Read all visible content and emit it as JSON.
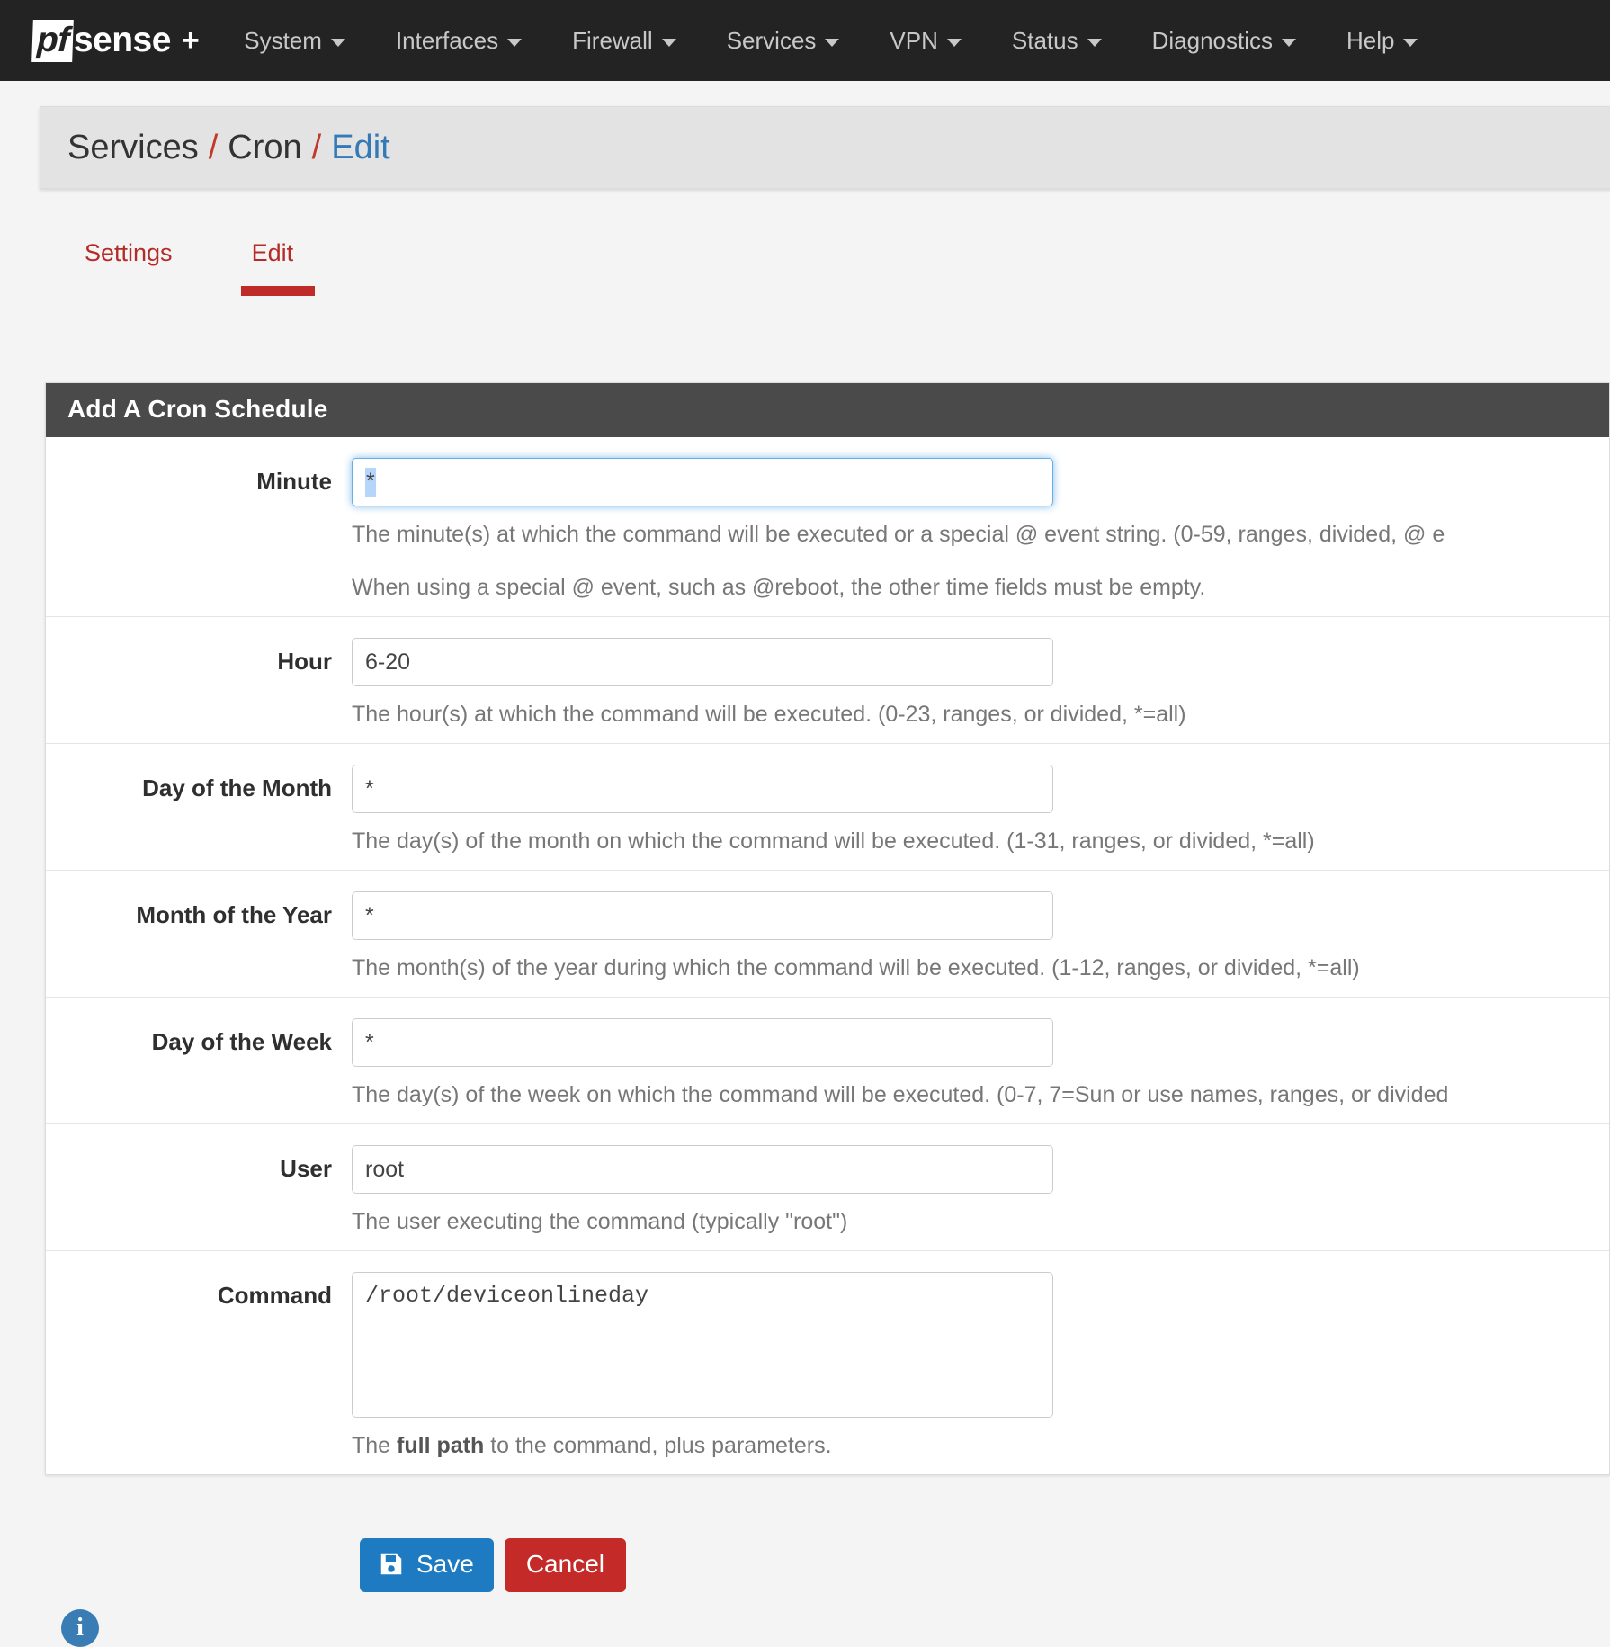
{
  "navbar": {
    "brand": {
      "pf": "pf",
      "sense": "sense",
      "plus": "+"
    },
    "items": [
      {
        "label": "System",
        "icon": "chevron-down-icon"
      },
      {
        "label": "Interfaces",
        "icon": "chevron-down-icon"
      },
      {
        "label": "Firewall",
        "icon": "chevron-down-icon"
      },
      {
        "label": "Services",
        "icon": "chevron-down-icon"
      },
      {
        "label": "VPN",
        "icon": "chevron-down-icon"
      },
      {
        "label": "Status",
        "icon": "chevron-down-icon"
      },
      {
        "label": "Diagnostics",
        "icon": "chevron-down-icon"
      },
      {
        "label": "Help",
        "icon": "chevron-down-icon"
      }
    ]
  },
  "breadcrumb": {
    "root": "Services",
    "sep1": "/",
    "section": "Cron",
    "sep2": "/",
    "current": "Edit"
  },
  "tabs": [
    {
      "label": "Settings",
      "active": false
    },
    {
      "label": "Edit",
      "active": true
    }
  ],
  "panel": {
    "title": "Add A Cron Schedule",
    "rows": [
      {
        "label": "Minute",
        "value": "*",
        "focused": true,
        "help": "The minute(s) at which the command will be executed or a special @ event string. (0-59, ranges, divided, @ e",
        "help2": "When using a special @ event, such as @reboot, the other time fields must be empty."
      },
      {
        "label": "Hour",
        "value": "6-20",
        "focused": false,
        "help": "The hour(s) at which the command will be executed. (0-23, ranges, or divided, *=all)"
      },
      {
        "label": "Day of the Month",
        "value": "*",
        "focused": false,
        "help": "The day(s) of the month on which the command will be executed. (1-31, ranges, or divided, *=all)"
      },
      {
        "label": "Month of the Year",
        "value": "*",
        "focused": false,
        "help": "The month(s) of the year during which the command will be executed. (1-12, ranges, or divided, *=all)"
      },
      {
        "label": "Day of the Week",
        "value": "*",
        "focused": false,
        "help": "The day(s) of the week on which the command will be executed. (0-7, 7=Sun or use names, ranges, or divided"
      },
      {
        "label": "User",
        "value": "root",
        "focused": false,
        "help": "The user executing the command (typically \"root\")"
      }
    ],
    "command_row": {
      "label": "Command",
      "value": "/root/deviceonlineday",
      "help_pre": "The ",
      "help_strong": "full path",
      "help_post": " to the command, plus parameters."
    }
  },
  "buttons": {
    "save": {
      "label": "Save",
      "icon": "floppy-disk-icon",
      "color": "#1f7bc1"
    },
    "cancel": {
      "label": "Cancel",
      "color": "#c42b28"
    }
  },
  "footer": {
    "info_icon": "info-circle-icon",
    "info_glyph": "i"
  },
  "colors": {
    "navbar_bg": "#232323",
    "breadcrumb_bg": "#e3e3e3",
    "accent_red": "#bf2b28",
    "link_blue": "#337ab7",
    "panel_heading_bg": "#4a4a4a"
  }
}
